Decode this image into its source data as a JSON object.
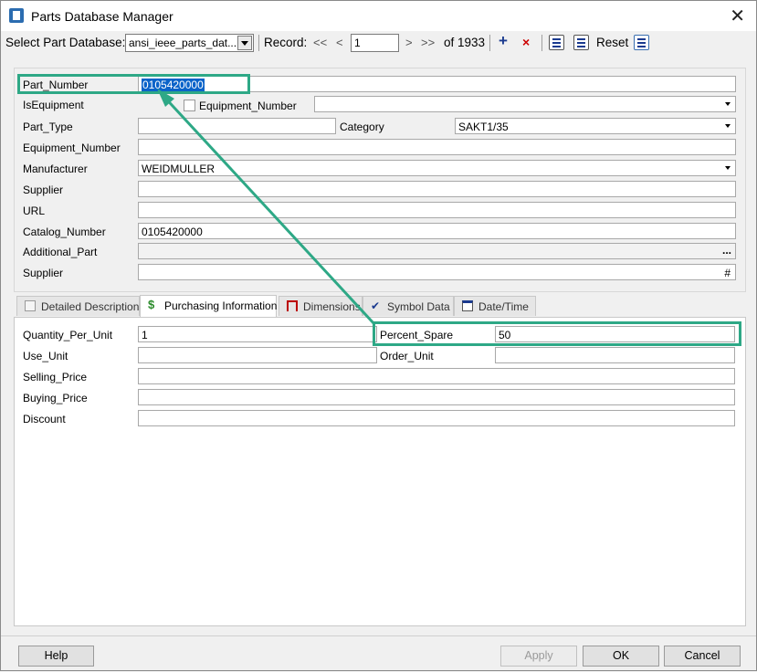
{
  "window": {
    "title": "Parts Database Manager"
  },
  "toolbar": {
    "select_db_label": "Select Part Database:",
    "db_value": "ansi_ieee_parts_dat...",
    "record_label": "Record:",
    "first": "<<",
    "prev": "<",
    "record_value": "1",
    "next": ">",
    "last": ">>",
    "of_total": "of 1933",
    "add": "+",
    "delete": "×",
    "reset": "Reset"
  },
  "fields": {
    "part_number": {
      "label": "Part_Number",
      "value": "0105420000"
    },
    "is_equipment": {
      "label": "IsEquipment",
      "checkbox_label": "Equipment_Number",
      "value": ""
    },
    "part_type": {
      "label": "Part_Type",
      "value": ""
    },
    "category": {
      "label": "Category",
      "value": "SAKT1/35"
    },
    "equipment_number": {
      "label": "Equipment_Number",
      "value": ""
    },
    "manufacturer": {
      "label": "Manufacturer",
      "value": "WEIDMULLER"
    },
    "supplier": {
      "label": "Supplier",
      "value": ""
    },
    "url": {
      "label": "URL",
      "value": ""
    },
    "catalog_number": {
      "label": "Catalog_Number",
      "value": "0105420000"
    },
    "additional_part": {
      "label": "Additional_Part",
      "value": "",
      "button": "..."
    },
    "supplier2": {
      "label": "Supplier",
      "value": "",
      "button": "#"
    }
  },
  "tabs": [
    {
      "label": "Detailed Description",
      "icon": "description-icon"
    },
    {
      "label": "Purchasing Information",
      "icon": "dollar-icon"
    },
    {
      "label": "Dimensions",
      "icon": "dimensions-icon"
    },
    {
      "label": "Symbol Data",
      "icon": "symbol-icon"
    },
    {
      "label": "Date/Time",
      "icon": "calendar-icon"
    }
  ],
  "purchasing": {
    "quantity_per_unit": {
      "label": "Quantity_Per_Unit",
      "value": "1"
    },
    "percent_spare": {
      "label": "Percent_Spare",
      "value": "50"
    },
    "use_unit": {
      "label": "Use_Unit",
      "value": ""
    },
    "order_unit": {
      "label": "Order_Unit",
      "value": ""
    },
    "selling_price": {
      "label": "Selling_Price",
      "value": ""
    },
    "buying_price": {
      "label": "Buying_Price",
      "value": ""
    },
    "discount": {
      "label": "Discount",
      "value": ""
    }
  },
  "buttons": {
    "help": "Help",
    "apply": "Apply",
    "ok": "OK",
    "cancel": "Cancel"
  },
  "colors": {
    "highlight": "#2ea886",
    "selection": "#0a63c9",
    "delete": "#c00000",
    "add": "#1a3a8f"
  }
}
